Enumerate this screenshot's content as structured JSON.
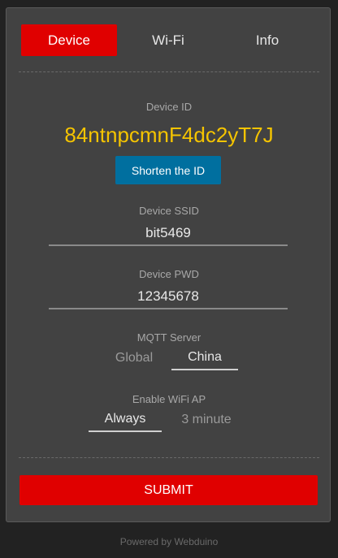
{
  "tabs": [
    {
      "label": "Device",
      "active": true
    },
    {
      "label": "Wi-Fi",
      "active": false
    },
    {
      "label": "Info",
      "active": false
    }
  ],
  "device": {
    "id_label": "Device ID",
    "id_value": "84ntnpcmnF4dc2yT7J",
    "shorten_button": "Shorten the ID",
    "ssid_label": "Device SSID",
    "ssid_value": "bit5469",
    "pwd_label": "Device PWD",
    "pwd_value": "12345678"
  },
  "mqtt": {
    "label": "MQTT Server",
    "options": [
      "Global",
      "China"
    ],
    "selected": "China"
  },
  "wifi_ap": {
    "label": "Enable WiFi AP",
    "options": [
      "Always",
      "3 minute"
    ],
    "selected": "Always"
  },
  "submit_label": "SUBMIT",
  "footer": "Powered by Webduino",
  "colors": {
    "accent": "#e00000",
    "id_color": "#f5c400",
    "button_blue": "#006f9f",
    "card_bg": "#424242",
    "page_bg": "#222222"
  }
}
